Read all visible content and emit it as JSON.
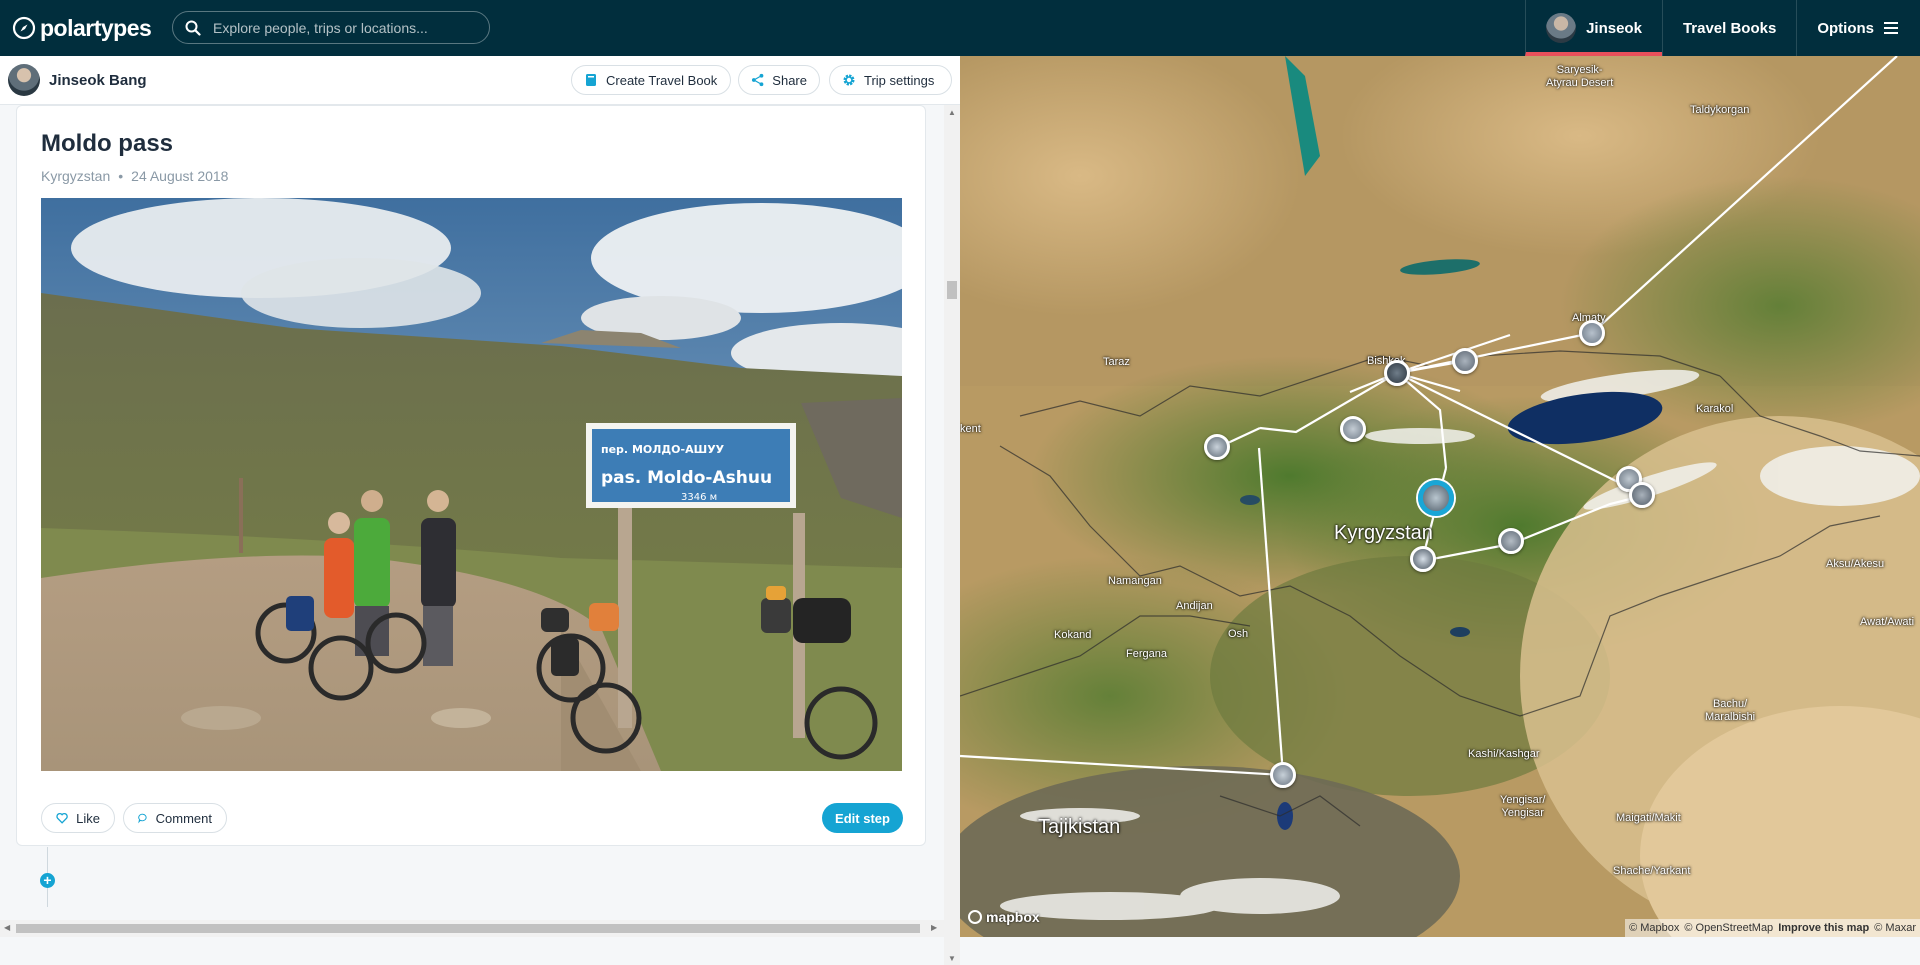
{
  "navbar": {
    "brand": "polartypes",
    "search_placeholder": "Explore people, trips or locations...",
    "user_name": "Jinseok",
    "travel_books": "Travel Books",
    "options": "Options"
  },
  "trip_header": {
    "author": "Jinseok Bang",
    "create_travel_book": "Create Travel Book",
    "share": "Share",
    "trip_settings": "Trip settings"
  },
  "step": {
    "title": "Moldo pass",
    "location": "Kyrgyzstan",
    "date": "24 August 2018",
    "photo_sign_line1": "пер. МОЛДО-АШУУ",
    "photo_sign_line2": "pas. Moldo-Ashuu",
    "photo_sign_line3": "3346 м",
    "like": "Like",
    "comment": "Comment",
    "edit": "Edit step"
  },
  "map": {
    "labels": {
      "desert": "Saryesik-\nAtyrau Desert",
      "taldykorgan": "Taldykorgan",
      "almaty": "Almaty",
      "bishkek": "Bishkek",
      "taraz": "Taraz",
      "karakol": "Karakol",
      "shymkent": "kent",
      "kyrgyzstan": "Kyrgyzstan",
      "namangan": "Namangan",
      "andijan": "Andijan",
      "kokand": "Kokand",
      "fergana": "Fergana",
      "osh": "Osh",
      "aksu": "Aksu/Akesu",
      "awat": "Awat/Awati",
      "bachu": "Bachu/\nMaralbishi",
      "kashgar": "Kashi/Kashgar",
      "yengisar": "Yengisar/\nYengisar",
      "maigati": "Maigati/Makit",
      "shache": "Shache/Yarkant",
      "tajikistan": "Tajikistan"
    },
    "logo": "mapbox",
    "attribution": {
      "mapbox": "© Mapbox",
      "osm": "© OpenStreetMap",
      "improve": "Improve this map",
      "maxar": "© Maxar"
    }
  },
  "colors": {
    "navbar": "#012e3d",
    "accent": "#15a4d3",
    "active_underline": "#e8505b"
  }
}
